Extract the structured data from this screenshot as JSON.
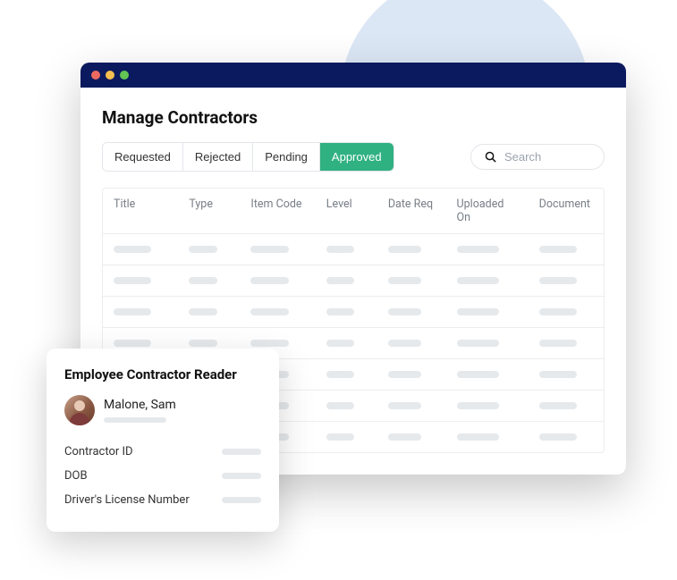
{
  "page": {
    "title": "Manage Contractors"
  },
  "tabs": [
    {
      "label": "Requested",
      "active": false
    },
    {
      "label": "Rejected",
      "active": false
    },
    {
      "label": "Pending",
      "active": false
    },
    {
      "label": "Approved",
      "active": true
    }
  ],
  "search": {
    "placeholder": "Search"
  },
  "table": {
    "columns": [
      "Title",
      "Type",
      "Item Code",
      "Level",
      "Date Req",
      "Uploaded On",
      "Document"
    ],
    "row_count": 7
  },
  "card": {
    "title": "Employee Contractor Reader",
    "person_name": "Malone, Sam",
    "fields": [
      {
        "label": "Contractor ID"
      },
      {
        "label": "DOB"
      },
      {
        "label": "Driver's License Number"
      }
    ]
  }
}
